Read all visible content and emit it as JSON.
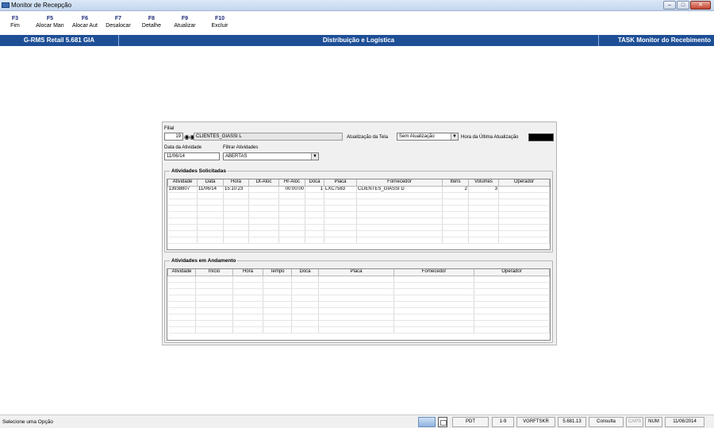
{
  "window": {
    "title": "Monitor de Recepção",
    "min_glyph": "–",
    "max_glyph": "□",
    "close_glyph": "✕"
  },
  "fkeys": [
    {
      "key": "F3",
      "label": "Fim"
    },
    {
      "key": "F5",
      "label": "Alocar Man"
    },
    {
      "key": "F6",
      "label": "Alocar Aut"
    },
    {
      "key": "F7",
      "label": "Desalocar"
    },
    {
      "key": "F8",
      "label": "Detalhe"
    },
    {
      "key": "F9",
      "label": "Atualizar"
    },
    {
      "key": "F10",
      "label": "Excluir"
    }
  ],
  "banner": {
    "left": "G-RMS Retail 5.681 GIA",
    "center": "Distribuição e Logística",
    "right": "TASK Monitor do Recebimento"
  },
  "form": {
    "filial_label": "Filial",
    "filial_value": "19",
    "filial_name": "CLIENTES_GIASSI L",
    "atualizacao_label": "Atualização da Tela",
    "atualizacao_value": "Sem Atualização",
    "hora_label": "Hora da Última Atualização",
    "data_label": "Data da Atividade",
    "data_value": "11/06/14",
    "filtrar_label": "Filtrar Atividades",
    "filtrar_value": "ABERTAS"
  },
  "solicitadas": {
    "title": "Atividades Solicitadas",
    "columns": [
      "Atividade",
      "Data",
      "Hora",
      "Dt-Aloc",
      "Hr-Aloc",
      "Doca",
      "Placa",
      "Fornecedor",
      "Itens",
      "Volumes",
      "Operador"
    ],
    "rows": [
      [
        "13938807",
        "11/06/14",
        "15:10:23",
        "",
        "00:00:00",
        "1",
        "LXC7583",
        "CLIENTES_GIASSI D",
        "2",
        "3",
        ""
      ]
    ]
  },
  "andamento": {
    "title": "Atividades em Andamento",
    "columns": [
      "Atividade",
      "Início",
      "Hora",
      "Tempo",
      "Doca",
      "Placa",
      "Fornecedor",
      "Operador"
    ],
    "rows": []
  },
  "statusbar": {
    "message": "Selecione uma Opção",
    "panels": [
      "PDT",
      "1-9",
      "VGRFTSKR",
      "5.681.13",
      "Consulta",
      "CAPS",
      "NUM",
      "11/06/2014"
    ]
  },
  "icons": {
    "app": "app-icon",
    "search": "binoculars-icon",
    "combo": "chevron-down-icon",
    "network": "network-icon",
    "doc": "document-icon"
  }
}
